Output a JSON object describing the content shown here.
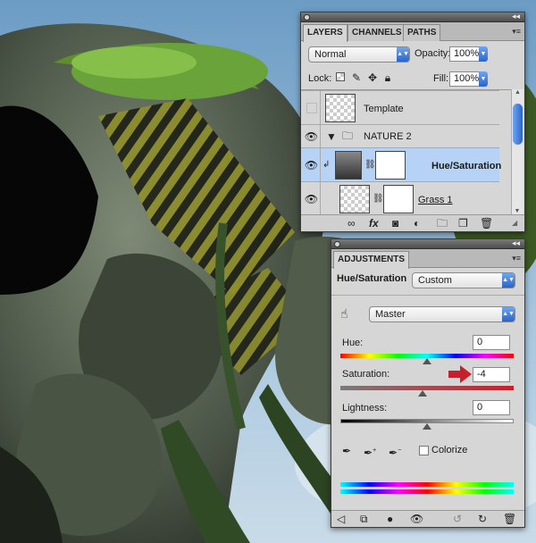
{
  "layers_panel": {
    "tabs": [
      {
        "label": "LAYERS"
      },
      {
        "label": "CHANNELS"
      },
      {
        "label": "PATHS"
      }
    ],
    "blend_mode": "Normal",
    "opacity_label": "Opacity:",
    "opacity_value": "100%",
    "lock_label": "Lock:",
    "fill_label": "Fill:",
    "fill_value": "100%",
    "layers": [
      {
        "name": "Template",
        "visible": false,
        "type": "layer"
      },
      {
        "name": "NATURE 2",
        "visible": true,
        "type": "group"
      },
      {
        "name": "Hue/Saturation",
        "visible": true,
        "type": "adjustment",
        "selected": true
      },
      {
        "name": "Grass 1",
        "visible": true,
        "type": "layer"
      }
    ],
    "footer_icons": [
      "link-icon",
      "fx-icon",
      "mask-icon",
      "adjustment-icon",
      "folder-icon",
      "new-layer-icon",
      "trash-icon"
    ]
  },
  "adjustments_panel": {
    "tab": "ADJUSTMENTS",
    "title": "Hue/Saturation",
    "preset": "Custom",
    "channel": "Master",
    "hue_label": "Hue:",
    "hue_value": "0",
    "saturation_label": "Saturation:",
    "saturation_value": "-4",
    "lightness_label": "Lightness:",
    "lightness_value": "0",
    "colorize_label": "Colorize",
    "colorize_checked": false,
    "accent_color": "#c8202a",
    "footer_icons": [
      "back-icon",
      "expand-icon",
      "clip-icon",
      "eye-icon",
      "reset-icon",
      "refresh-icon",
      "trash-icon"
    ]
  }
}
